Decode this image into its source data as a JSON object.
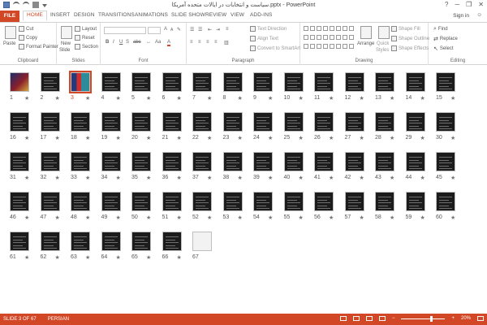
{
  "titlebar": {
    "title": "سیاست و انتخابات در ایالات متحده آمریکا.pptx - PowerPoint",
    "minimize": "─",
    "restore": "❐",
    "close": "✕",
    "help": "?"
  },
  "tabs": {
    "file": "FILE",
    "home": "HOME",
    "insert": "INSERT",
    "design": "DESIGN",
    "transitions": "TRANSITIONS",
    "animations": "ANIMATIONS",
    "slideshow": "SLIDE SHOW",
    "review": "REVIEW",
    "view": "VIEW",
    "addins": "ADD-INS",
    "signin": "Sign in"
  },
  "ribbon": {
    "clipboard": {
      "label": "Clipboard",
      "paste": "Paste",
      "cut": "Cut",
      "copy": "Copy",
      "format_painter": "Format Painter"
    },
    "slides": {
      "label": "Slides",
      "new_slide": "New",
      "new_slide2": "Slide",
      "layout": "Layout",
      "reset": "Reset",
      "section": "Section"
    },
    "font": {
      "label": "Font",
      "bold": "B",
      "italic": "I",
      "underline": "U",
      "strike": "S",
      "abc": "abc",
      "grow": "A",
      "shrink": "A"
    },
    "paragraph": {
      "label": "Paragraph",
      "text_direction": "Text Direction",
      "align_text": "Align Text",
      "convert_smartart": "Convert to SmartArt"
    },
    "drawing": {
      "label": "Drawing",
      "arrange": "Arrange",
      "quick_styles": "Quick",
      "quick_styles2": "Styles",
      "shape_fill": "Shape Fill",
      "shape_outline": "Shape Outline",
      "shape_effects": "Shape Effects"
    },
    "editing": {
      "label": "Editing",
      "find": "Find",
      "replace": "Replace",
      "select": "Select"
    }
  },
  "slides": {
    "selected": 3,
    "star": "★",
    "numbers": [
      "1",
      "2",
      "3",
      "4",
      "5",
      "6",
      "7",
      "8",
      "9",
      "10",
      "11",
      "12",
      "13",
      "14",
      "15",
      "16",
      "17",
      "18",
      "19",
      "20",
      "21",
      "22",
      "23",
      "24",
      "25",
      "26",
      "27",
      "28",
      "29",
      "30",
      "31",
      "32",
      "33",
      "34",
      "35",
      "36",
      "37",
      "38",
      "39",
      "40",
      "41",
      "42",
      "43",
      "44",
      "45",
      "46",
      "47",
      "48",
      "49",
      "50",
      "51",
      "52",
      "53",
      "54",
      "55",
      "56",
      "57",
      "58",
      "59",
      "60",
      "61",
      "62",
      "63",
      "64",
      "65",
      "66",
      "67"
    ]
  },
  "status": {
    "slide_info": "SLIDE 3 OF 67",
    "language": "PERSIAN",
    "zoom": "20%"
  },
  "colors": {
    "accent": "#d24726",
    "slide_bg": "#1c1c1c"
  }
}
